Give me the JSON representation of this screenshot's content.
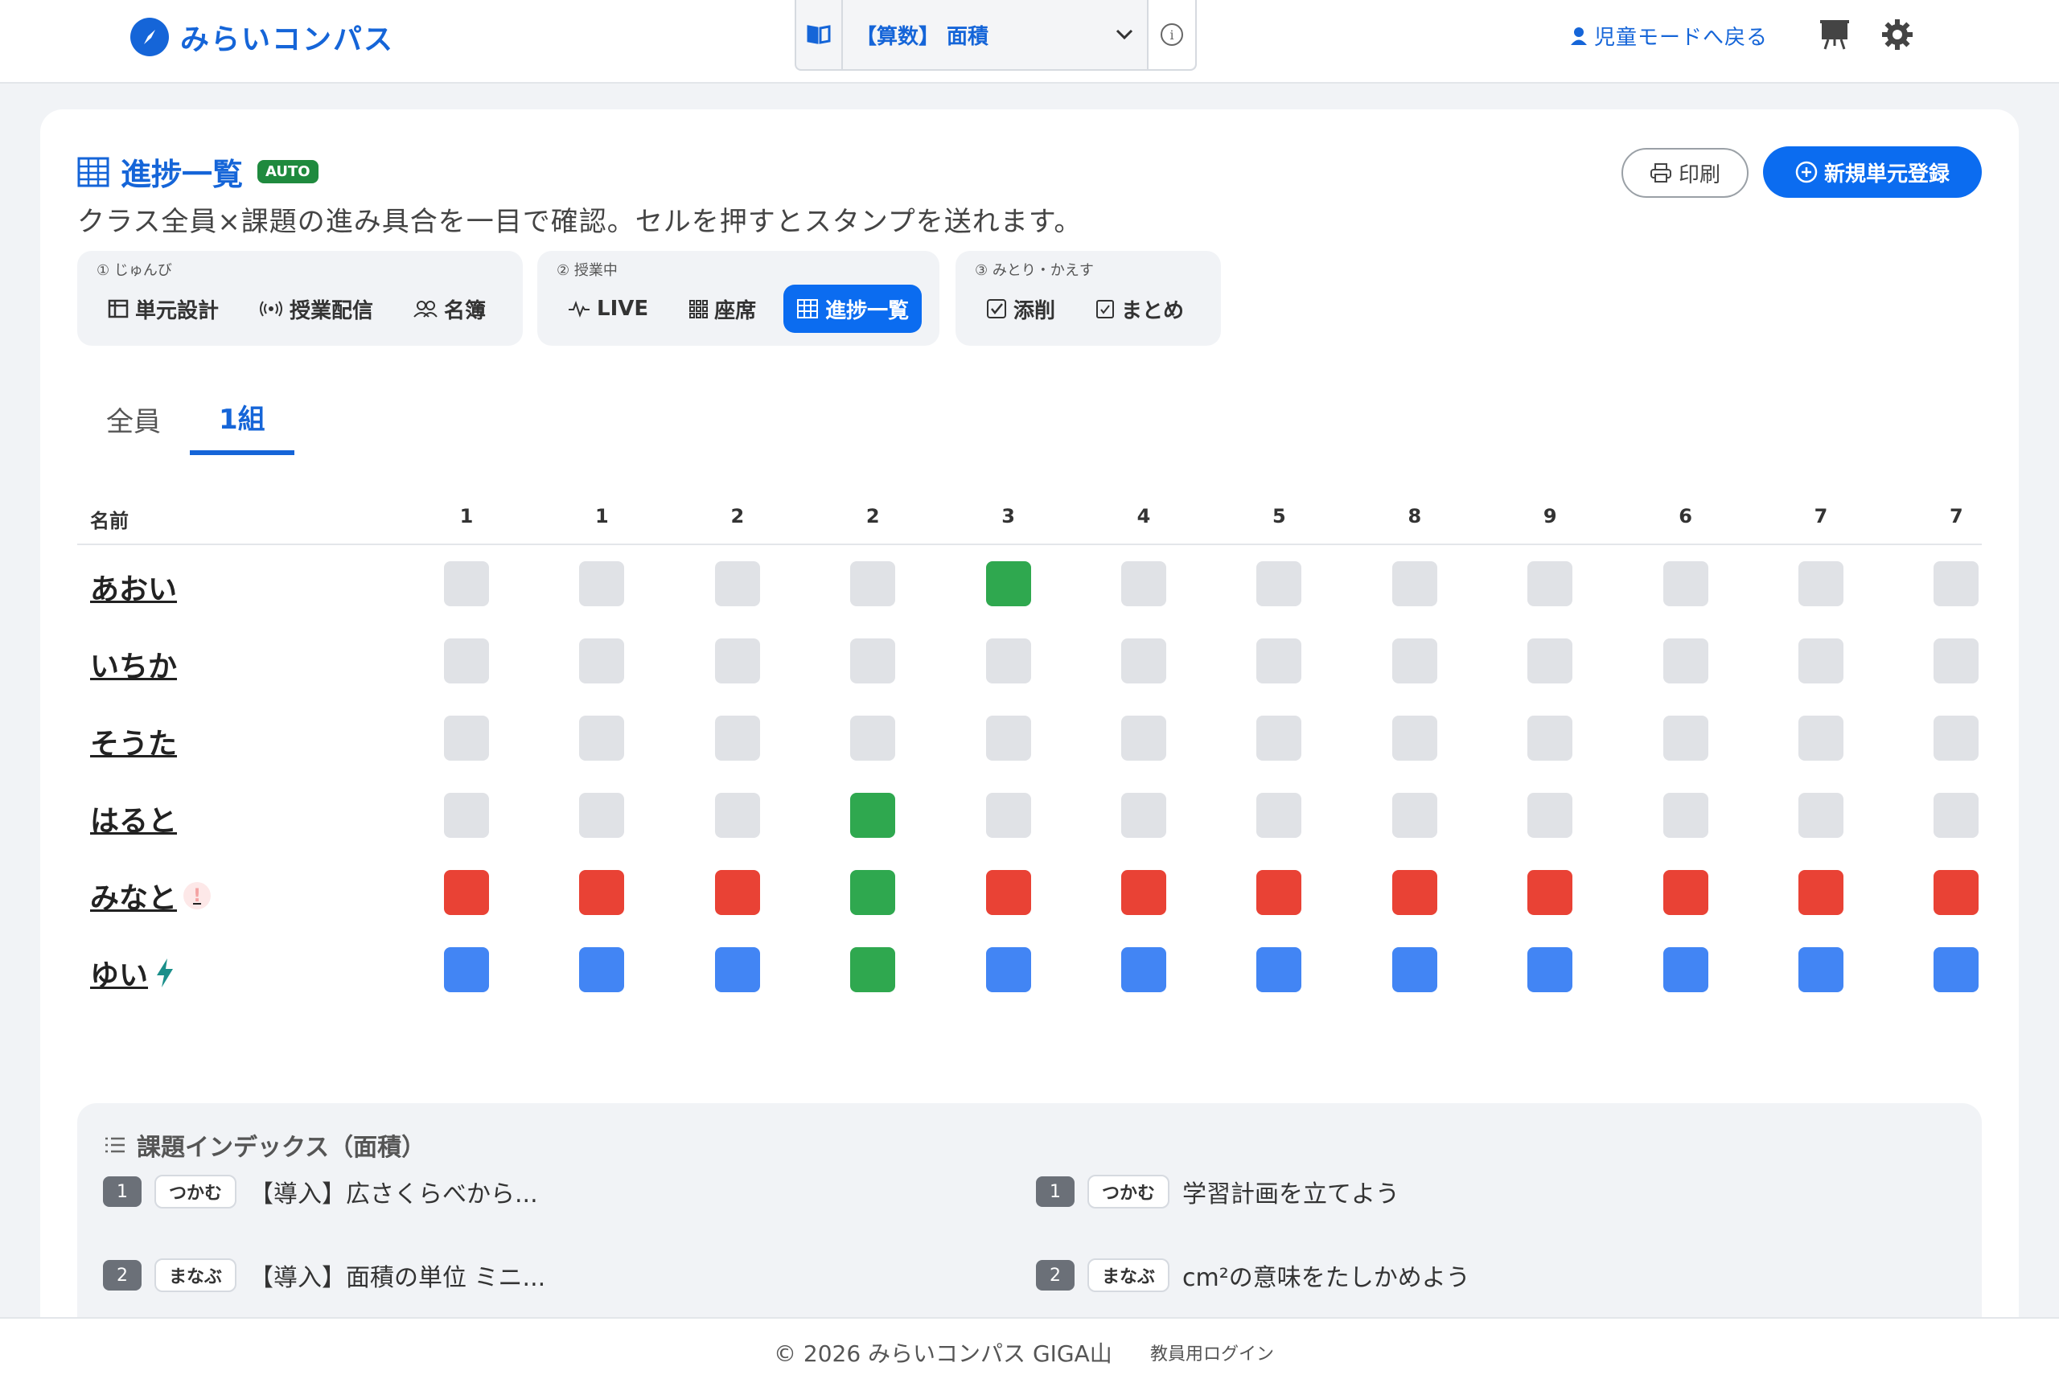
{
  "header": {
    "app_name": "みらいコンパス",
    "unit_select": "【算数】 面積",
    "info": "i",
    "back_link": "児童モードへ戻る"
  },
  "page": {
    "title": "進捗一覧",
    "badge": "AUTO",
    "subtitle": "クラス全員×課題の進み具合を一目で確認。セルを押すとスタンプを送れます。",
    "print_label": "印刷",
    "new_unit_label": "新規単元登録"
  },
  "steps": [
    {
      "head": "① じゅんび",
      "items": [
        "単元設計",
        "授業配信",
        "名簿"
      ]
    },
    {
      "head": "② 授業中",
      "items": [
        "LIVE",
        "座席",
        "進捗一覧"
      ]
    },
    {
      "head": "③ みとり・かえす",
      "items": [
        "添削",
        "まとめ"
      ]
    }
  ],
  "tabs": [
    "全員",
    "1組"
  ],
  "grid": {
    "name_header": "名前",
    "columns": [
      "1",
      "1",
      "2",
      "2",
      "3",
      "4",
      "5",
      "8",
      "9",
      "6",
      "7",
      "7"
    ],
    "rows": [
      {
        "name": "あおい",
        "status": [
          "g",
          "g",
          "g",
          "g",
          "green",
          "g",
          "g",
          "g",
          "g",
          "g",
          "g",
          "g"
        ]
      },
      {
        "name": "いちか",
        "status": [
          "g",
          "g",
          "g",
          "g",
          "g",
          "g",
          "g",
          "g",
          "g",
          "g",
          "g",
          "g"
        ]
      },
      {
        "name": "そうた",
        "status": [
          "g",
          "g",
          "g",
          "g",
          "g",
          "g",
          "g",
          "g",
          "g",
          "g",
          "g",
          "g"
        ]
      },
      {
        "name": "はると",
        "status": [
          "g",
          "g",
          "g",
          "green",
          "g",
          "g",
          "g",
          "g",
          "g",
          "g",
          "g",
          "g"
        ]
      },
      {
        "name": "みなと",
        "marker": "alert",
        "status": [
          "red",
          "red",
          "red",
          "green",
          "red",
          "red",
          "red",
          "red",
          "red",
          "red",
          "red",
          "red"
        ]
      },
      {
        "name": "ゆい",
        "marker": "bolt",
        "status": [
          "blue",
          "blue",
          "blue",
          "green",
          "blue",
          "blue",
          "blue",
          "blue",
          "blue",
          "blue",
          "blue",
          "blue"
        ]
      }
    ]
  },
  "index": {
    "title": "課題インデックス（面積）",
    "items": [
      {
        "num": "1",
        "tag": "つかむ",
        "text": "【導入】広さくらべから..."
      },
      {
        "num": "1",
        "tag": "つかむ",
        "text": "学習計画を立てよう"
      },
      {
        "num": "2",
        "tag": "まなぶ",
        "text": "【導入】面積の単位 ミニ..."
      },
      {
        "num": "2",
        "tag": "まなぶ",
        "text": "cm²の意味をたしかめよう"
      }
    ]
  },
  "footer": {
    "copyright": "© 2026 みらいコンパス GIGA山",
    "login": "教員用ログイン"
  },
  "colors": {
    "brand": "#1565d8",
    "primary_button": "#0b6cf0",
    "done": "#2fa84f",
    "stuck": "#e94235",
    "in_progress": "#4285f4",
    "empty": "#e0e2e6",
    "badge": "#1f8a3e"
  }
}
